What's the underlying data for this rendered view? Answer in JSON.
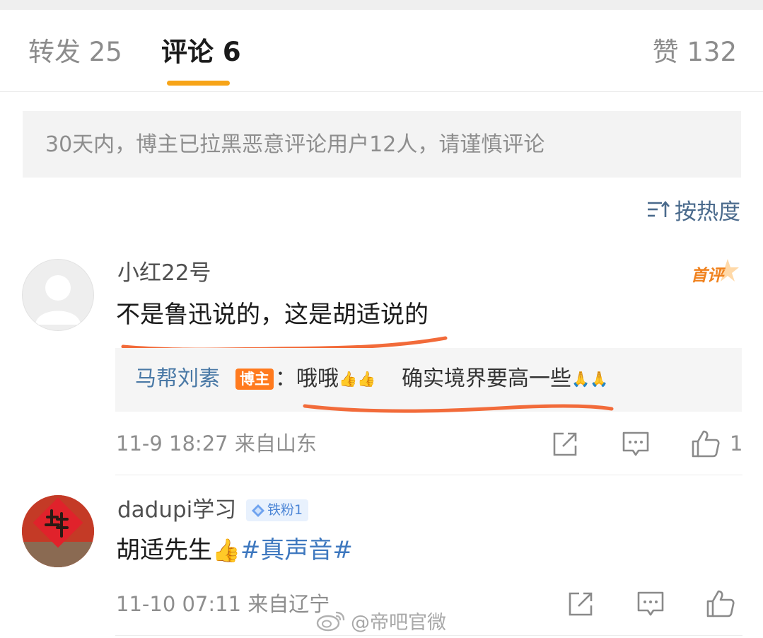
{
  "tabs": {
    "forward_label": "转发 25",
    "comments_label": "评论 6",
    "likes_label": "赞 132"
  },
  "notice": "30天内，博主已拉黑恶意评论用户12人，请谨慎评论",
  "sort_label": "按热度",
  "comments": [
    {
      "username": "小红22号",
      "text": "不是鲁迅说的，这是胡适说的",
      "first_badge": "首评",
      "reply": {
        "author": "马帮刘素",
        "role_badge": "博主",
        "text_part1": "：哦哦",
        "emoji1": "👍👍",
        "text_part2": "确实境界要高一些",
        "emoji2": "🙏🙏"
      },
      "meta": "11-9 18:27 来自山东",
      "like_count": "1"
    },
    {
      "username": "dadupi学习",
      "fan_badge": "铁粉1",
      "text_prefix": "胡适先生",
      "text_emoji": "👍",
      "hashtag": "#真声音#",
      "meta": "11-10 07:11 来自辽宁"
    }
  ],
  "watermark": "@帝吧官微",
  "colors": {
    "accent_underline": "#f7a418",
    "link_blue": "#4a79a6",
    "annotation_orange": "#f26b3a"
  }
}
